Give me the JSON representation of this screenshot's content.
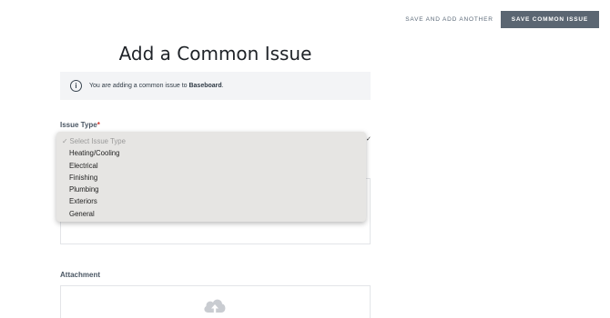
{
  "toolbar": {
    "save_and_add_label": "SAVE AND ADD ANOTHER",
    "save_label": "SAVE COMMON ISSUE"
  },
  "page": {
    "title": "Add a Common Issue"
  },
  "info": {
    "prefix": "You are adding a common issue to ",
    "target": "Baseboard",
    "suffix": ".",
    "icon": "info-icon"
  },
  "issue_type": {
    "label": "Issue Type",
    "required_marker": "*",
    "placeholder_check": "✓",
    "placeholder": "Select Issue Type",
    "options": [
      "Heating/Cooling",
      "Electrical",
      "Finishing",
      "Plumbing",
      "Exteriors",
      "General"
    ]
  },
  "attachment": {
    "label": "Attachment",
    "icon": "cloud-upload-icon"
  },
  "colors": {
    "primary_button": "#5b6672",
    "required": "#d0342c",
    "dropdown_bg": "#e6e5e3"
  }
}
